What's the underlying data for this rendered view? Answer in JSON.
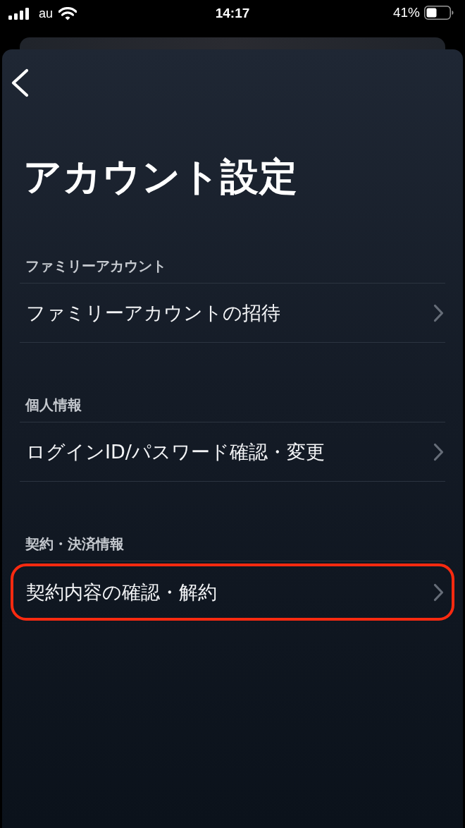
{
  "status_bar": {
    "carrier": "au",
    "time": "14:17",
    "battery": "41%"
  },
  "title": "アカウント設定",
  "sections": [
    {
      "header": "ファミリーアカウント",
      "items": [
        {
          "label": "ファミリーアカウントの招待",
          "highlighted": false
        }
      ]
    },
    {
      "header": "個人情報",
      "items": [
        {
          "label": "ログインID/パスワード確認・変更",
          "highlighted": false
        }
      ]
    },
    {
      "header": "契約・決済情報",
      "items": [
        {
          "label": "契約内容の確認・解約",
          "highlighted": true
        }
      ]
    }
  ]
}
